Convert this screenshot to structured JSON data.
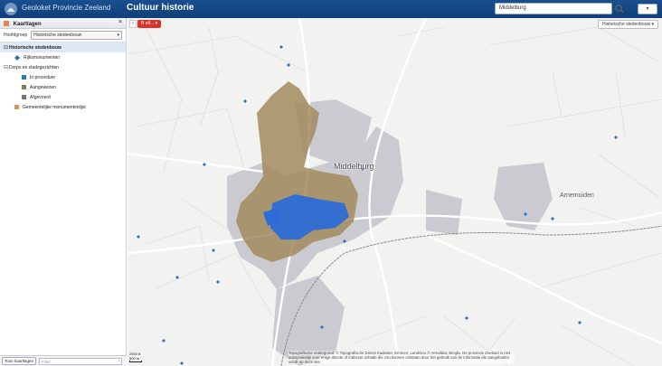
{
  "header": {
    "app_name": "Geoloket Provincie Zeeland",
    "page_title": "Cultuur historie",
    "search_value": "Middelburg",
    "user_menu": "▾"
  },
  "sidebar": {
    "title": "Kaartlagen",
    "close": "×",
    "group_label": "Hoofdgroep",
    "group_value": "Historische stedenbouw",
    "tree": [
      {
        "label": "Historische stedenbouw",
        "toggle": "⊟",
        "selected": true
      },
      {
        "label": "Rijksmonumenten",
        "swatch": "#2f6fc7",
        "swatch_shape": "diamond"
      },
      {
        "label": "Dorps en stadsgezichten",
        "toggle": "⊟"
      },
      {
        "label": "In procedure",
        "swatch": "#1f7fb0"
      },
      {
        "label": "Aangewezen",
        "swatch": "#8f7a4e"
      },
      {
        "label": "Afgevoerd",
        "swatch": "#777777"
      },
      {
        "label": "Gemeentelijke monumentenlijst",
        "swatch": "#d09a5c"
      }
    ],
    "footer_button": "Toon kaartlagen",
    "filter_placeholder": "Filter",
    "filter_clear": "×"
  },
  "map": {
    "collapse": "‹",
    "badge": "B elf... ▾",
    "basemap_button": "Historische stedenbouw ▾",
    "city_labels": [
      "Middelburg",
      "Arnemuiden"
    ],
    "attribution": "Topografische ondergrond: © Topografische Dienst Kadaster, Emmen; LandGeo © Aerodata; Bergla. De provincie Zeeland is niet aansprakelijk voor enige directe of indirecte schade die zou kunnen ontstaan door het gebruik van de informatie die aangeboden wordt op deze site.",
    "scale_label": "2500 ft\n500 m",
    "colors": {
      "protected_area": "#a28b5d",
      "monument": "#2f6fc7",
      "built_up": "#c9c9cf",
      "roads": "#ffffff"
    }
  }
}
